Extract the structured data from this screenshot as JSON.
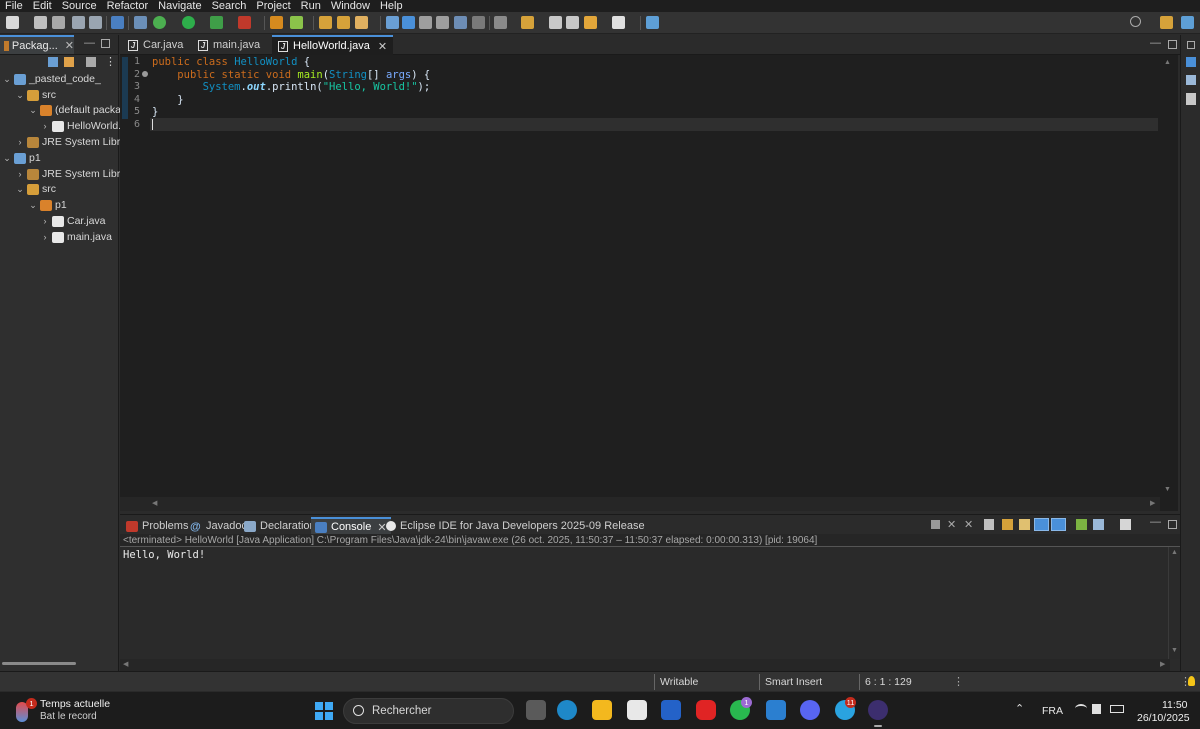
{
  "menu": [
    "File",
    "Edit",
    "Source",
    "Refactor",
    "Navigate",
    "Search",
    "Project",
    "Run",
    "Window",
    "Help"
  ],
  "package_explorer": {
    "tab_label": "Packag...",
    "tree": [
      {
        "label": "_pasted_code_",
        "icon": "project-icon",
        "expanded": true
      },
      {
        "label": "src",
        "icon": "source-folder-icon",
        "expanded": true
      },
      {
        "label": "(default packag",
        "icon": "package-icon",
        "expanded": true
      },
      {
        "label": "HelloWorld.",
        "icon": "java-file-icon",
        "expanded": false
      },
      {
        "label": "JRE System Library",
        "icon": "library-icon",
        "expanded": false
      },
      {
        "label": "p1",
        "icon": "project-icon",
        "expanded": true
      },
      {
        "label": "JRE System Library",
        "icon": "library-icon",
        "expanded": false
      },
      {
        "label": "src",
        "icon": "source-folder-icon",
        "expanded": true
      },
      {
        "label": "p1",
        "icon": "package-icon",
        "expanded": true
      },
      {
        "label": "Car.java",
        "icon": "java-file-icon",
        "expanded": false
      },
      {
        "label": "main.java",
        "icon": "java-file-icon",
        "expanded": false
      }
    ]
  },
  "editor": {
    "tabs": [
      "Car.java",
      "main.java",
      "HelloWorld.java"
    ],
    "active_tab": "HelloWorld.java",
    "line_numbers": [
      "1",
      "2",
      "3",
      "4",
      "5",
      "6"
    ],
    "code": {
      "l1_kw": "public class ",
      "l1_cls": "HelloWorld",
      "l1_end": " {",
      "l2_indent": "    ",
      "l2_kw": "public static void ",
      "l2_method": "main",
      "l2_open": "(",
      "l2_type": "String",
      "l2_arr": "[] ",
      "l2_param": "args",
      "l2_end": ") {",
      "l3_indent": "        ",
      "l3_sys": "System",
      "l3_dot": ".",
      "l3_fld": "out",
      "l3_call": ".println(",
      "l3_str": "\"Hello, World!\"",
      "l3_end": ");",
      "l4": "    }",
      "l5": "}"
    }
  },
  "console": {
    "tabs": [
      "Problems",
      "Javadoc",
      "Declaration",
      "Console",
      "Eclipse IDE for Java Developers 2025-09 Release"
    ],
    "active_tab": "Console",
    "status": "<terminated> HelloWorld [Java Application] C:\\Program Files\\Java\\jdk-24\\bin\\javaw.exe  (26 oct. 2025, 11:50:37 – 11:50:37 elapsed: 0:00:00.313) [pid: 19064]",
    "output": "Hello, World!"
  },
  "statusbar": {
    "writable": "Writable",
    "insert_mode": "Smart Insert",
    "position": "6 : 1 : 129"
  },
  "taskbar": {
    "weather_title": "Temps actuelle",
    "weather_sub": "Bat le record",
    "weather_badge": "1",
    "search_placeholder": "Rechercher",
    "whatsapp_badge": "1",
    "telegram_badge": "11",
    "language": "FRA",
    "time": "11:50",
    "date": "26/10/2025"
  },
  "colors": {
    "accent": "#4a90d9",
    "keyword": "#cc6c1d",
    "class": "#1290c3",
    "string": "#17c6a3",
    "editor_bg": "#1f1f1f"
  }
}
